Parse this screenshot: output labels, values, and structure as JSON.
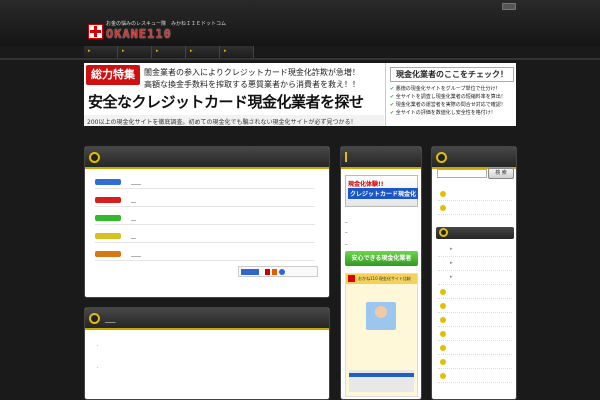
{
  "header": {
    "tagline": "お金の悩みのレスキュー隊　みかねＩＩＥドットコム",
    "logo_text": "OKANE110"
  },
  "nav": {
    "items": [
      "▸",
      "▸",
      "▸",
      "▸",
      "▸"
    ]
  },
  "banner": {
    "badge": "総力特集",
    "line1": "闇金業者の参入によりクレジットカード現金化詐欺が急増！",
    "line2": "高額な換金手数料を搾取する悪質業者から消費者を救え！！",
    "title": "安全なクレジットカード現金化業者を探せ",
    "footer": "200以上の現金化サイトを徹底調査。初めての現金化でも騙されない現金化サイトが必ず見つかる！",
    "right_title": "現金化業者のここをチェック！",
    "right_items": [
      "悪徳の現金化サイトをグループ単位で仕分け！",
      "全サイトを調査し現金化業者の短縮料率を算出！",
      "現金化業者の運営者を実際の問合せ対応で確認！",
      "全サイトの評価を数値化し安全性を格付け！"
    ]
  },
  "main1": {
    "rows": [
      {
        "label": "____",
        "color": "#2f6ed8"
      },
      {
        "label": "__",
        "color": "#d81d1d"
      },
      {
        "label": "__",
        "color": "#32b82a"
      },
      {
        "label": "__",
        "color": "#d6c21e"
      },
      {
        "label": "____",
        "color": "#d57816"
      }
    ],
    "badges_text": "Bl  "
  },
  "main2": {
    "head": "___",
    "dot": "."
  },
  "side1": {
    "banner_red": "現金化体験!!",
    "banner_blue": "クレジットカード現金化",
    "green_button": "安心できる現金化業者",
    "shot_title": "おかね110 現金化サイト比較",
    "dashes": [
      "_",
      "_",
      "_"
    ]
  },
  "side2": {
    "search_button": "検 索",
    "list_count": 10
  }
}
